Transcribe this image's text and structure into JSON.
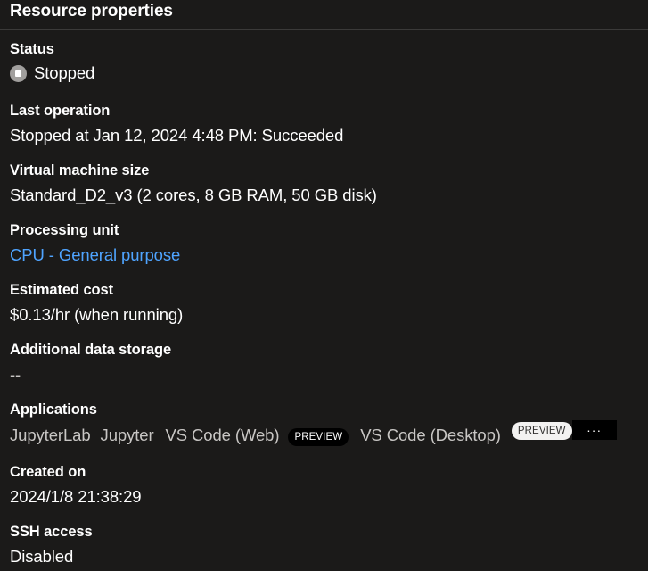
{
  "header": {
    "title": "Resource properties"
  },
  "status": {
    "label": "Status",
    "value": "Stopped",
    "icon": "stopped-icon",
    "icon_color": "#a19f9d"
  },
  "last_operation": {
    "label": "Last operation",
    "value": "Stopped at Jan 12, 2024 4:48 PM: Succeeded"
  },
  "vm_size": {
    "label": "Virtual machine size",
    "value": "Standard_D2_v3 (2 cores, 8 GB RAM, 50 GB disk)"
  },
  "processing_unit": {
    "label": "Processing unit",
    "value": "CPU - General purpose",
    "link_color": "#4fa4ff"
  },
  "estimated_cost": {
    "label": "Estimated cost",
    "value": "$0.13/hr (when running)"
  },
  "additional_storage": {
    "label": "Additional data storage",
    "value": "--"
  },
  "applications": {
    "label": "Applications",
    "items": [
      "JupyterLab",
      "Jupyter",
      "VS Code (Web)",
      "VS Code (Desktop)"
    ],
    "preview_badge": "PREVIEW",
    "more_label": "···"
  },
  "created_on": {
    "label": "Created on",
    "value": "2024/1/8 21:38:29"
  },
  "ssh_access": {
    "label": "SSH access",
    "value": "Disabled"
  }
}
